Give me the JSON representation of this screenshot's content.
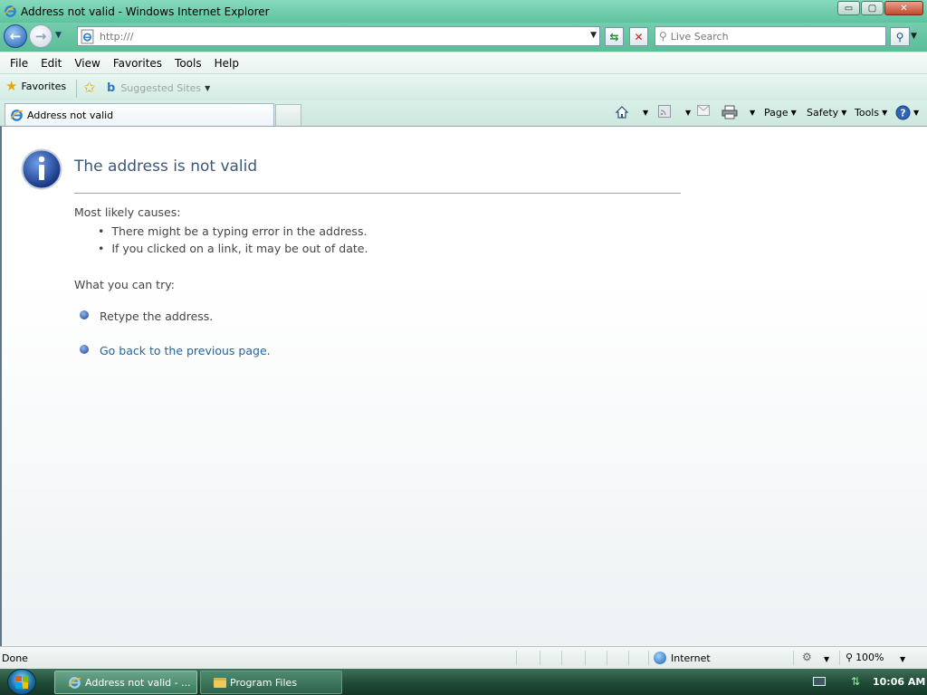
{
  "window": {
    "title": "Address not valid - Windows Internet Explorer",
    "minimize_glyph": "▭",
    "maximize_glyph": "▢",
    "close_glyph": "✕"
  },
  "navbar": {
    "address_value": "",
    "address_placeholder": "http:///",
    "search_placeholder": "Live Search"
  },
  "menubar": {
    "items": [
      "File",
      "Edit",
      "View",
      "Favorites",
      "Tools",
      "Help"
    ]
  },
  "favorites_bar": {
    "favorites_label": "Favorites",
    "suggested_sites_label": "Suggested Sites"
  },
  "tabs": {
    "active_tab_label": "Address not valid"
  },
  "command_bar": {
    "page_label": "Page",
    "safety_label": "Safety",
    "tools_label": "Tools"
  },
  "content": {
    "title": "The address is not valid",
    "causes_label": "Most likely causes:",
    "causes": [
      "There might be a typing error in the address.",
      "If you clicked on a link, it may be out of date."
    ],
    "try_label": "What you can try:",
    "try_items": [
      "Retype the address.",
      "Go back to the previous page."
    ]
  },
  "statusbar": {
    "status_text": "Done",
    "zone_label": "Internet",
    "zoom_level": "100%"
  },
  "taskbar": {
    "tasks": [
      "Address not valid - ...",
      "Program Files"
    ],
    "clock": "10:06 AM"
  },
  "colors": {
    "title_blue": "#3b587a",
    "link_blue": "#1f64a8",
    "chrome_green": "#5fc39f",
    "taskbar_green": "#1e4a35"
  },
  "icons": [
    "ie-logo-icon",
    "back-arrow-icon",
    "forward-arrow-icon",
    "refresh-icon",
    "stop-icon",
    "search-icon",
    "favorites-star-icon",
    "add-favorites-icon",
    "bing-icon",
    "home-icon",
    "feeds-icon",
    "mail-icon",
    "print-icon",
    "help-icon",
    "info-icon",
    "globe-icon",
    "zoom-icon",
    "windows-start-icon",
    "folder-icon"
  ]
}
